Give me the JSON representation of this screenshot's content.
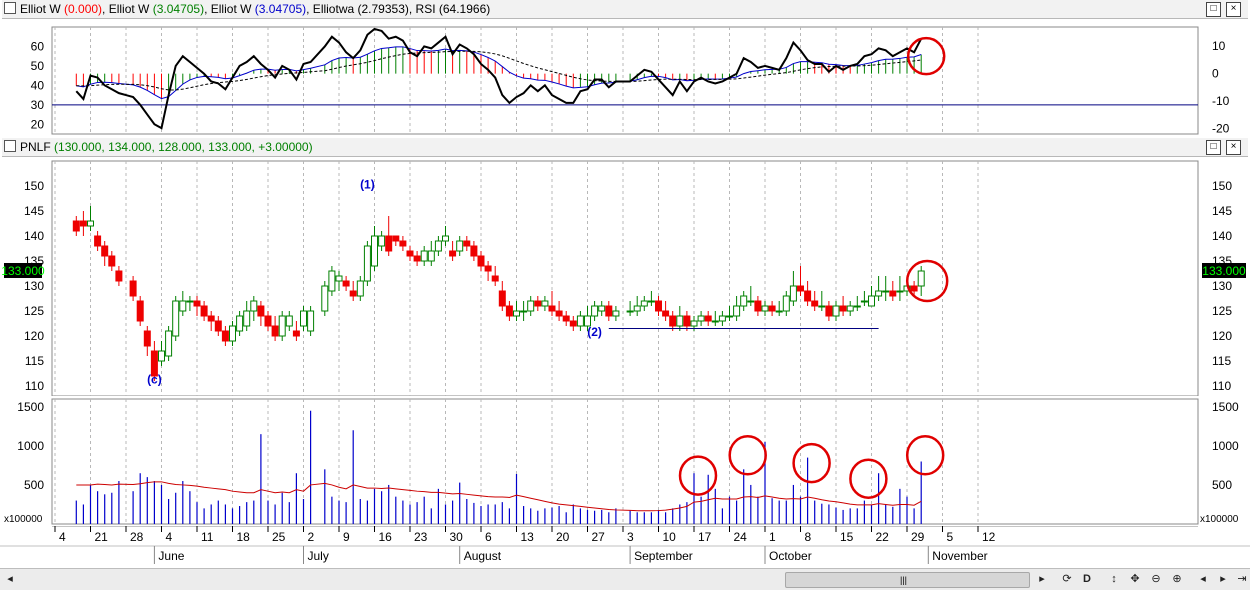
{
  "rsi_panel": {
    "title_parts": [
      {
        "text": "Elliot W ",
        "color": "#000000"
      },
      {
        "text": "(0.000)",
        "color": "#ff0000"
      },
      {
        "text": ", Elliot W ",
        "color": "#000000"
      },
      {
        "text": "(3.04705)",
        "color": "#008000"
      },
      {
        "text": ", Elliot W ",
        "color": "#000000"
      },
      {
        "text": "(3.04705)",
        "color": "#0000cc"
      },
      {
        "text": ", Elliotwa (2.79353), RSI (64.1966)",
        "color": "#000000"
      }
    ],
    "left_ticks": [
      "60",
      "50",
      "40",
      "30",
      "20"
    ],
    "right_ticks": [
      "10",
      "0",
      "-10",
      "-20"
    ]
  },
  "price_panel": {
    "title_symbol": "PNLF",
    "title_values": "(130.000, 134.000, 128.000, 133.000, +3.00000)",
    "ticks": [
      "150",
      "145",
      "140",
      "135",
      "130",
      "125",
      "120",
      "115",
      "110"
    ],
    "last_price": "133.000",
    "wave_labels": [
      "(c)",
      "(1)",
      "(2)"
    ]
  },
  "volume_panel": {
    "ticks": [
      "1500",
      "1000",
      "500"
    ],
    "multiplier": "x100000"
  },
  "x_axis": {
    "day_labels": [
      "4",
      "21",
      "28",
      "4",
      "11",
      "18",
      "25",
      "2",
      "9",
      "16",
      "23",
      "30",
      "6",
      "13",
      "20",
      "27",
      "3",
      "10",
      "17",
      "24",
      "1",
      "8",
      "15",
      "22",
      "29",
      "5",
      "12"
    ],
    "month_labels": [
      "June",
      "July",
      "August",
      "September",
      "October",
      "November"
    ]
  },
  "toolbar": {
    "icons": [
      "scroll-left-icon",
      "scroll-right-icon",
      "refresh-icon",
      "daily-icon",
      "resize-vertical-icon",
      "move-icon",
      "zoom-out-icon",
      "zoom-in-icon",
      "prev-icon",
      "next-icon",
      "end-icon"
    ],
    "daily_label": "D"
  },
  "annotation_color": "#e00000",
  "chart_data": {
    "type": "candlestick",
    "symbol": "PNLF",
    "x_dates": [
      "2012-05-17",
      "2012-05-18",
      "2012-05-21",
      "2012-05-22",
      "2012-05-23",
      "2012-05-24",
      "2012-05-25",
      "2012-05-29",
      "2012-05-30",
      "2012-05-31",
      "2012-06-01",
      "2012-06-04",
      "2012-06-05",
      "2012-06-06",
      "2012-06-07",
      "2012-06-08",
      "2012-06-11",
      "2012-06-12",
      "2012-06-13",
      "2012-06-14",
      "2012-06-15",
      "2012-06-18",
      "2012-06-19",
      "2012-06-20",
      "2012-06-21",
      "2012-06-22",
      "2012-06-25",
      "2012-06-26",
      "2012-06-27",
      "2012-06-28",
      "2012-06-29",
      "2012-07-02",
      "2012-07-03",
      "2012-07-05",
      "2012-07-06",
      "2012-07-09",
      "2012-07-10",
      "2012-07-11",
      "2012-07-12",
      "2012-07-13",
      "2012-07-16",
      "2012-07-17",
      "2012-07-18",
      "2012-07-19",
      "2012-07-20",
      "2012-07-23",
      "2012-07-24",
      "2012-07-25",
      "2012-07-26",
      "2012-07-27",
      "2012-07-30",
      "2012-07-31",
      "2012-08-01",
      "2012-08-02",
      "2012-08-03",
      "2012-08-06",
      "2012-08-07",
      "2012-08-08",
      "2012-08-09",
      "2012-08-10",
      "2012-08-13",
      "2012-08-14",
      "2012-08-15",
      "2012-08-16",
      "2012-08-17",
      "2012-08-20",
      "2012-08-21",
      "2012-08-22",
      "2012-08-23",
      "2012-08-24",
      "2012-08-27",
      "2012-08-28",
      "2012-08-29",
      "2012-08-30",
      "2012-08-31",
      "2012-09-04",
      "2012-09-05",
      "2012-09-06",
      "2012-09-07",
      "2012-09-10",
      "2012-09-11",
      "2012-09-12",
      "2012-09-13",
      "2012-09-14",
      "2012-09-17",
      "2012-09-18",
      "2012-09-19",
      "2012-09-20",
      "2012-09-21",
      "2012-09-24",
      "2012-09-25",
      "2012-09-26",
      "2012-09-27",
      "2012-09-28",
      "2012-10-01",
      "2012-10-02",
      "2012-10-03",
      "2012-10-04",
      "2012-10-05",
      "2012-10-08",
      "2012-10-09",
      "2012-10-10",
      "2012-10-11",
      "2012-10-12",
      "2012-10-15",
      "2012-10-16",
      "2012-10-17",
      "2012-10-18",
      "2012-10-19",
      "2012-10-22",
      "2012-10-23",
      "2012-10-24",
      "2012-10-25",
      "2012-10-26",
      "2012-10-29",
      "2012-10-30",
      "2012-10-31"
    ],
    "open": [
      143,
      143,
      142,
      140,
      138,
      136,
      133,
      131,
      127,
      121,
      117,
      115,
      116,
      120,
      125,
      127,
      127,
      126,
      124,
      123,
      121,
      119,
      121,
      122,
      125,
      126,
      124,
      122,
      120,
      122,
      121,
      122,
      121,
      125,
      129,
      131,
      131,
      129,
      128,
      131,
      134,
      138,
      140,
      140,
      139,
      137,
      136,
      135,
      135,
      137,
      139,
      137,
      137,
      139,
      138,
      136,
      134,
      132,
      129,
      126,
      124,
      125,
      125,
      127,
      126,
      126,
      125,
      124,
      123,
      122,
      122,
      124,
      125,
      126,
      124,
      125,
      125,
      126,
      127,
      127,
      125,
      124,
      122,
      124,
      122,
      123,
      124,
      123,
      123,
      124,
      124,
      126,
      127,
      127,
      125,
      126,
      125,
      125,
      127,
      130,
      129,
      127,
      126,
      126,
      124,
      126,
      125,
      126,
      127,
      126,
      128,
      129,
      129,
      129,
      129,
      130,
      130
    ],
    "close": [
      141,
      142,
      143,
      138,
      136,
      134,
      131,
      128,
      123,
      118,
      112,
      117,
      121,
      127,
      127,
      127,
      126,
      124,
      123,
      121,
      119,
      122,
      124,
      125,
      127,
      124,
      122,
      120,
      124,
      124,
      120,
      125,
      125,
      130,
      133,
      132,
      130,
      128,
      131,
      138,
      140,
      140,
      137,
      139,
      138,
      136,
      135,
      137,
      137,
      139,
      140,
      136,
      139,
      138,
      136,
      134,
      133,
      131,
      126,
      124,
      125,
      125,
      127,
      126,
      127,
      125,
      124,
      123,
      122,
      124,
      124,
      126,
      126,
      124,
      125,
      125,
      126,
      127,
      127,
      125,
      124,
      122,
      124,
      122,
      123,
      124,
      123,
      123,
      124,
      124,
      126,
      128,
      127,
      125,
      126,
      125,
      125,
      128,
      130,
      129,
      127,
      126,
      126,
      124,
      126,
      125,
      126,
      126,
      127,
      128,
      129,
      129,
      128,
      129,
      130,
      129,
      133
    ],
    "high": [
      144,
      145,
      146,
      141,
      139,
      137,
      134,
      132,
      128,
      122,
      119,
      119,
      122,
      128,
      129,
      128,
      128,
      127,
      125,
      124,
      122,
      123,
      125,
      127,
      128,
      127,
      125,
      124,
      125,
      125,
      123,
      126,
      126,
      131,
      134,
      133,
      132,
      131,
      132,
      139,
      142,
      141,
      144,
      140,
      140,
      138,
      137,
      138,
      139,
      140,
      142,
      139,
      140,
      140,
      139,
      137,
      135,
      134,
      131,
      127,
      127,
      127,
      128,
      128,
      128,
      129,
      127,
      125,
      124,
      125,
      126,
      127,
      127,
      127,
      126,
      127,
      128,
      128,
      129,
      128,
      127,
      125,
      126,
      125,
      124,
      125,
      125,
      125,
      125,
      126,
      128,
      129,
      130,
      128,
      127,
      127,
      127,
      129,
      133,
      134,
      131,
      129,
      129,
      127,
      127,
      128,
      127,
      128,
      129,
      130,
      132,
      132,
      131,
      132,
      131,
      131,
      134
    ],
    "low": [
      140,
      140,
      141,
      137,
      134,
      133,
      130,
      127,
      122,
      116,
      111,
      114,
      115,
      119,
      124,
      125,
      124,
      123,
      121,
      120,
      118,
      118,
      120,
      121,
      123,
      122,
      121,
      119,
      119,
      121,
      119,
      121,
      120,
      124,
      128,
      129,
      129,
      127,
      127,
      130,
      133,
      137,
      136,
      138,
      137,
      135,
      134,
      134,
      134,
      136,
      138,
      135,
      136,
      137,
      135,
      133,
      131,
      130,
      125,
      123,
      123,
      123,
      124,
      125,
      125,
      124,
      123,
      122,
      121,
      121,
      121,
      123,
      124,
      123,
      123,
      124,
      124,
      125,
      126,
      124,
      123,
      121,
      121,
      121,
      121,
      122,
      122,
      122,
      122,
      123,
      123,
      125,
      126,
      124,
      124,
      124,
      124,
      124,
      126,
      128,
      126,
      125,
      125,
      123,
      123,
      124,
      124,
      125,
      126,
      126,
      127,
      127,
      127,
      127,
      128,
      128,
      128
    ],
    "volume": [
      300,
      250,
      500,
      420,
      380,
      400,
      550,
      420,
      650,
      600,
      550,
      500,
      320,
      400,
      550,
      420,
      280,
      200,
      250,
      300,
      250,
      200,
      230,
      280,
      300,
      1150,
      300,
      250,
      400,
      280,
      650,
      320,
      1450,
      700,
      350,
      300,
      280,
      1200,
      320,
      300,
      450,
      420,
      500,
      350,
      300,
      250,
      280,
      350,
      200,
      450,
      250,
      300,
      530,
      320,
      270,
      230,
      250,
      250,
      280,
      200,
      640,
      230,
      200,
      170,
      200,
      210,
      230,
      150,
      250,
      200,
      180,
      170,
      180,
      150,
      200,
      170,
      150,
      150,
      150,
      180,
      150,
      200,
      250,
      280,
      650,
      350,
      630,
      450,
      200,
      350,
      300,
      700,
      500,
      350,
      1050,
      330,
      300,
      300,
      500,
      350,
      850,
      300,
      260,
      250,
      210,
      180,
      200,
      200,
      300,
      250,
      650,
      250,
      220,
      450,
      350,
      200,
      800,
      1000
    ],
    "volume_ma": [
      500,
      500,
      500,
      510,
      505,
      500,
      510,
      505,
      515,
      530,
      540,
      540,
      520,
      505,
      500,
      495,
      485,
      470,
      460,
      450,
      440,
      420,
      410,
      400,
      400,
      440,
      420,
      400,
      410,
      400,
      440,
      420,
      500,
      520,
      500,
      470,
      450,
      500,
      480,
      460,
      460,
      455,
      460,
      450,
      440,
      430,
      420,
      415,
      405,
      405,
      395,
      385,
      390,
      380,
      370,
      360,
      350,
      345,
      345,
      340,
      370,
      350,
      330,
      310,
      290,
      270,
      255,
      245,
      235,
      225,
      215,
      205,
      195,
      185,
      180,
      175,
      170,
      170,
      170,
      172,
      178,
      190,
      205,
      225,
      280,
      290,
      310,
      330,
      320,
      320,
      320,
      345,
      350,
      340,
      360,
      345,
      330,
      320,
      325,
      320,
      345,
      330,
      310,
      295,
      285,
      270,
      255,
      245,
      245,
      245,
      260,
      250,
      240,
      250,
      250,
      240,
      290,
      340
    ],
    "rsi": [
      37,
      33,
      45,
      44,
      40,
      38,
      36,
      34,
      30,
      25,
      20,
      18,
      35,
      50,
      55,
      52,
      49,
      46,
      42,
      41,
      38,
      44,
      50,
      52,
      55,
      51,
      48,
      44,
      50,
      48,
      43,
      51,
      52,
      60,
      65,
      62,
      57,
      54,
      58,
      66,
      69,
      68,
      64,
      65,
      63,
      57,
      55,
      60,
      59,
      62,
      65,
      56,
      61,
      59,
      56,
      51,
      48,
      44,
      35,
      31,
      34,
      36,
      40,
      37,
      40,
      35,
      33,
      31,
      31,
      37,
      38,
      43,
      43,
      39,
      42,
      42,
      45,
      48,
      47,
      43,
      39,
      35,
      42,
      37,
      42,
      44,
      42,
      41,
      42,
      44,
      46,
      54,
      52,
      49,
      50,
      49,
      48,
      54,
      62,
      58,
      53,
      51,
      51,
      47,
      50,
      48,
      50,
      51,
      55,
      56,
      59,
      58,
      55,
      57,
      59,
      57,
      64
    ],
    "rsi_ylim": [
      15,
      70
    ],
    "oscillator_right_ylim": [
      -22,
      17
    ],
    "ylim": [
      108,
      155
    ],
    "volume_ylim": [
      0,
      1600
    ],
    "volume_unit": "x100000",
    "support_line": {
      "start": "2012-08-30",
      "end": "2012-10-23",
      "value": 121.5
    },
    "wave_label_points": [
      {
        "label": "(c)",
        "date": "2012-06-01",
        "value": 110.5
      },
      {
        "label": "(1)",
        "date": "2012-07-13",
        "value": 149.5
      },
      {
        "label": "(2)",
        "date": "2012-08-28",
        "value": 120
      }
    ],
    "series": [
      {
        "name": "Elliot W (0.000)",
        "color": "#ff0000"
      },
      {
        "name": "Elliot W (3.04705)",
        "color": "#008000"
      },
      {
        "name": "Elliot W (3.04705)",
        "color": "#0000cc"
      },
      {
        "name": "Elliotwa (2.79353)",
        "color": "#000000"
      },
      {
        "name": "RSI (64.1966)",
        "color": "#000000"
      }
    ]
  }
}
